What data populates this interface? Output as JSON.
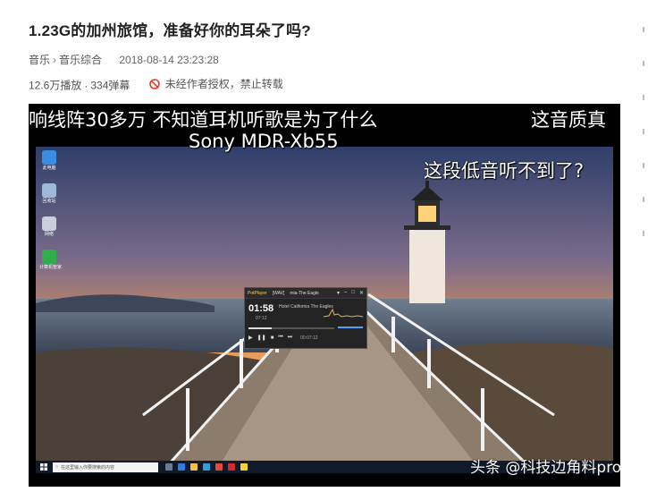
{
  "article": {
    "title": "1.23G的加州旅馆，准备好你的耳朵了吗?",
    "category": "音乐",
    "subcategory": "音乐综合",
    "timestamp": "2018-08-14 23:23:28",
    "plays": "12.6万播放",
    "separator": "·",
    "danmaku": "334弹幕",
    "copyright_notice": "未经作者授权，禁止转载"
  },
  "video": {
    "captions": {
      "top_left": "响线阵30多万 不知道耳机听歌是为了什么",
      "top_right": "这音质真",
      "device": "Sony MDR-Xb55",
      "bass": "这段低音听不到了?"
    },
    "watermark": "头条 @科技边角料pro",
    "player": {
      "app_name": "PotPlayer",
      "format": "[WAV]",
      "file": "mia-The Eagle",
      "current_time": "01:58",
      "sub_time": "07:12",
      "song": "Hotel California The Eagles",
      "duration": "00:07:12",
      "progress_fraction": 0.27
    },
    "taskbar": {
      "search_placeholder": "在这里输入你要搜索的内容"
    },
    "desktop_icons": [
      "此电脑",
      "回收站",
      "网络",
      "计算机管家"
    ]
  },
  "colors": {
    "warn_red": "#e8382c",
    "video_bg": "#000000",
    "taskbar": "#101a2b"
  }
}
